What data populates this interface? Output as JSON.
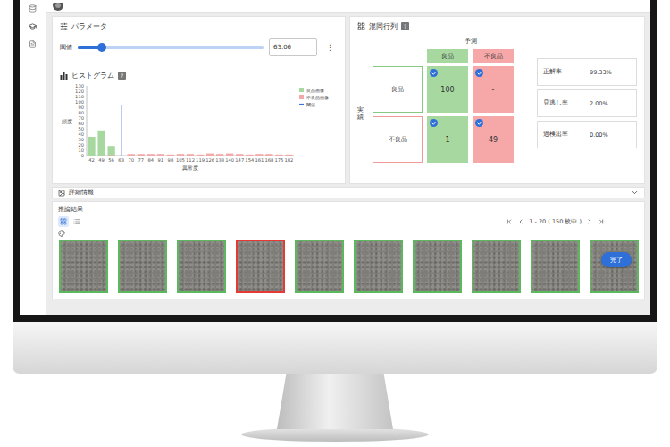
{
  "sidebar": {
    "items": [
      {
        "selected": false
      },
      {
        "selected": true
      },
      {
        "selected": false
      }
    ]
  },
  "parameters": {
    "title": "パラメータ",
    "threshold": {
      "label": "閾値",
      "value": "63.06",
      "level": 0.13,
      "menu": "⋮"
    }
  },
  "histogram": {
    "title": "ヒストグラム",
    "help": "?",
    "y_axis": {
      "title": "頻度",
      "ticks": [
        "130",
        "120",
        "110",
        "100",
        "90",
        "80",
        "70",
        "60",
        "50",
        "40",
        "30",
        "20",
        "10",
        "0"
      ]
    },
    "x_axis": {
      "title": "異常度",
      "ticks": [
        "42",
        "49",
        "56",
        "63",
        "70",
        "77",
        "84",
        "91",
        "98",
        "105",
        "112",
        "119",
        "126",
        "133",
        "140",
        "147",
        "154",
        "161",
        "168",
        "175",
        "182"
      ]
    },
    "legend": [
      {
        "label": "良品画像",
        "color": "#a6d8a0"
      },
      {
        "label": "不良品画像",
        "color": "#f4a9a8"
      },
      {
        "label": "閾値",
        "color": "#3d6fd6"
      }
    ],
    "series": [
      {
        "name": "良品画像",
        "color": "#a6d8a0",
        "values": [
          35,
          47,
          18,
          0,
          0,
          0,
          0,
          0,
          0,
          0,
          0,
          0,
          0,
          0,
          0,
          0,
          0,
          0,
          0,
          0,
          0
        ]
      },
      {
        "name": "不良品画像",
        "color": "#f4a9a8",
        "values": [
          0,
          0,
          1,
          0,
          3,
          3,
          3,
          3,
          2,
          3,
          3,
          2,
          4,
          3,
          4,
          3,
          2,
          3,
          3,
          2,
          2
        ]
      }
    ],
    "threshold": 63.06
  },
  "confusion_matrix": {
    "title": "混同行列",
    "help": "?",
    "predicted_label": "予測",
    "actual_label": "実績",
    "columns": [
      {
        "label": "良品",
        "color": "#a6d8a0"
      },
      {
        "label": "不良品",
        "color": "#f6a8a8"
      }
    ],
    "rows": [
      {
        "label": "良品",
        "color": "#86c982",
        "cells": [
          {
            "value": "100",
            "checked": true,
            "color": "#a6d8a0"
          },
          {
            "value": "-",
            "checked": true,
            "color": "#f6a8a8"
          }
        ]
      },
      {
        "label": "不良品",
        "color": "#f09a9a",
        "cells": [
          {
            "value": "1",
            "checked": true,
            "color": "#a6d8a0"
          },
          {
            "value": "49",
            "checked": true,
            "color": "#f6a8a8"
          }
        ]
      }
    ]
  },
  "metrics": [
    {
      "label": "正解率",
      "value": "99.33%"
    },
    {
      "label": "見逃し率",
      "value": "2.00%"
    },
    {
      "label": "過検出率",
      "value": "0.00%"
    }
  ],
  "details": {
    "title": "詳細情報",
    "expanded": false
  },
  "results": {
    "title": "推論結果",
    "views": [
      {
        "kind": "grid",
        "selected": true
      },
      {
        "kind": "list",
        "selected": false
      }
    ],
    "pagination": {
      "range": "1 - 20 ( 150 枚中 )"
    },
    "images": [
      {
        "color": "#5cb85c"
      },
      {
        "color": "#5cb85c"
      },
      {
        "color": "#5cb85c"
      },
      {
        "color": "#e53935"
      },
      {
        "color": "#5cb85c"
      },
      {
        "color": "#5cb85c"
      },
      {
        "color": "#5cb85c"
      },
      {
        "color": "#5cb85c"
      },
      {
        "color": "#5cb85c"
      },
      {
        "color": "#5cb85c"
      }
    ],
    "complete_button": "完了"
  }
}
